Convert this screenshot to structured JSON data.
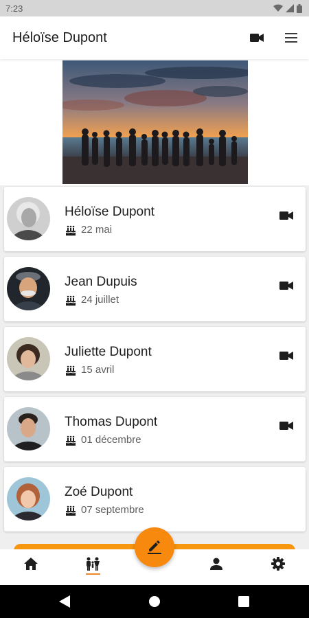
{
  "status_bar": {
    "time": "7:23"
  },
  "app_bar": {
    "title": "Héloïse Dupont",
    "video_icon": "video-icon",
    "menu_icon": "menu-icon"
  },
  "hero": {
    "icon": "family-sunset-photo"
  },
  "contacts": [
    {
      "name": "Héloïse Dupont",
      "birthday": "22 mai",
      "has_video": true
    },
    {
      "name": "Jean Dupuis",
      "birthday": "24 juillet",
      "has_video": true
    },
    {
      "name": "Juliette Dupont",
      "birthday": "15 avril",
      "has_video": true
    },
    {
      "name": "Thomas Dupont",
      "birthday": "01 décembre",
      "has_video": true
    },
    {
      "name": "Zoé Dupont",
      "birthday": "07 septembre",
      "has_video": false
    }
  ],
  "bottom_nav": {
    "items": [
      "home-icon",
      "family-icon",
      "person-icon",
      "settings-icon"
    ],
    "selected": "family-icon",
    "fab_icon": "edit-icon"
  },
  "colors": {
    "accent": "#f7890f",
    "background": "#efefef",
    "card": "#ffffff"
  }
}
